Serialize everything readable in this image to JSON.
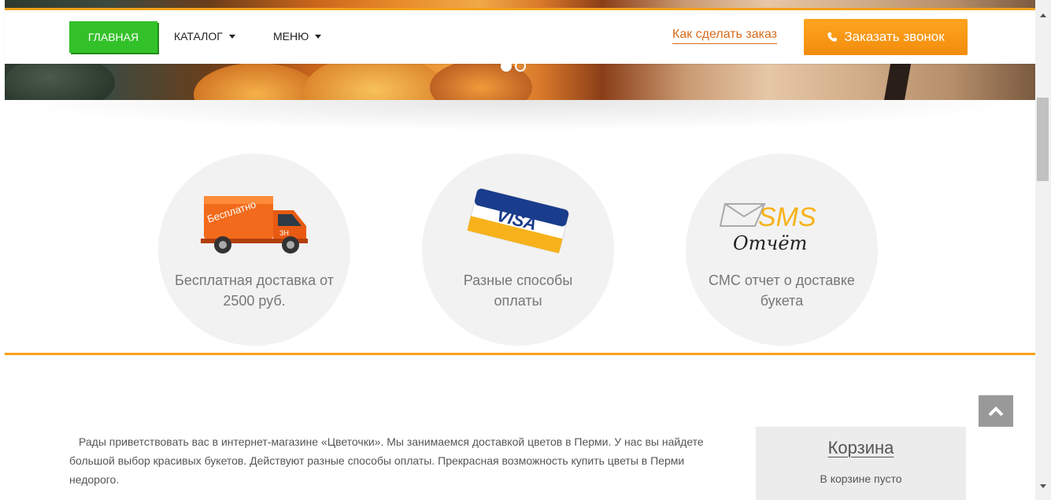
{
  "navbar": {
    "home_label": "ГЛАВНАЯ",
    "catalog_label": "КАТАЛОГ",
    "menu_label": "МЕНЮ",
    "howto_label": "Как сделать заказ",
    "call_label": "Заказать звонок"
  },
  "hero": {
    "slides_total": 2,
    "active_slide": 1
  },
  "features": [
    {
      "icon": "delivery-truck-icon",
      "truck_text": "Бесплатно",
      "truck_subtext": "ЗН",
      "text": "Бесплатная доставка от 2500 руб."
    },
    {
      "icon": "visa-card-icon",
      "card_text": "VISA",
      "text": "Разные способы оплаты"
    },
    {
      "icon": "sms-report-icon",
      "sms_text": "SMS",
      "report_text": "Отчёт",
      "text": "СМС отчет о доставке букета"
    }
  ],
  "welcome": {
    "text": "Рады приветствовать вас в интернет-магазине «Цветочки». Мы занимаемся доставкой цветов в Перми. У нас вы найдете большой выбор красивых букетов. Действуют разные способы оплаты. Прекрасная возможность купить цветы в Перми недорого."
  },
  "cart": {
    "title": "Корзина",
    "empty_text": "В корзине пусто"
  },
  "colors": {
    "accent_orange": "#f5a01a",
    "home_green": "#33c12a",
    "call_orange": "#f28c0c",
    "link_orange": "#d86a1b"
  }
}
